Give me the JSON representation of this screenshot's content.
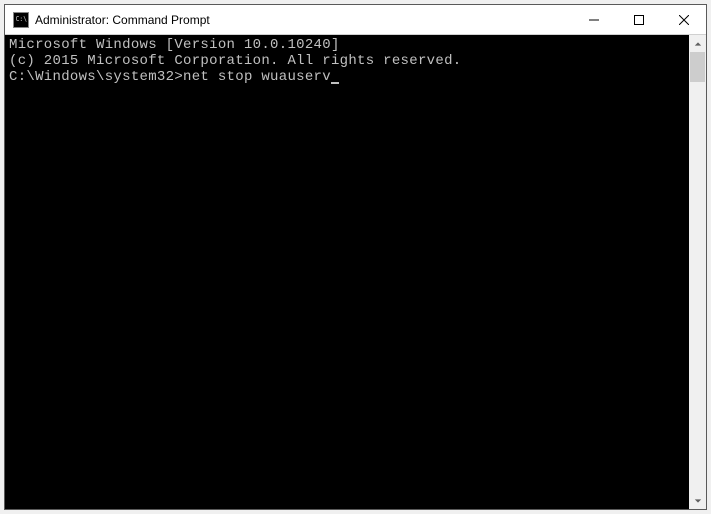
{
  "titlebar": {
    "icon_label": "C:\\",
    "title": "Administrator: Command Prompt"
  },
  "terminal": {
    "line1": "Microsoft Windows [Version 10.0.10240]",
    "line2": "(c) 2015 Microsoft Corporation. All rights reserved.",
    "blank": "",
    "prompt": "C:\\Windows\\system32>",
    "command": "net stop wuauserv"
  }
}
